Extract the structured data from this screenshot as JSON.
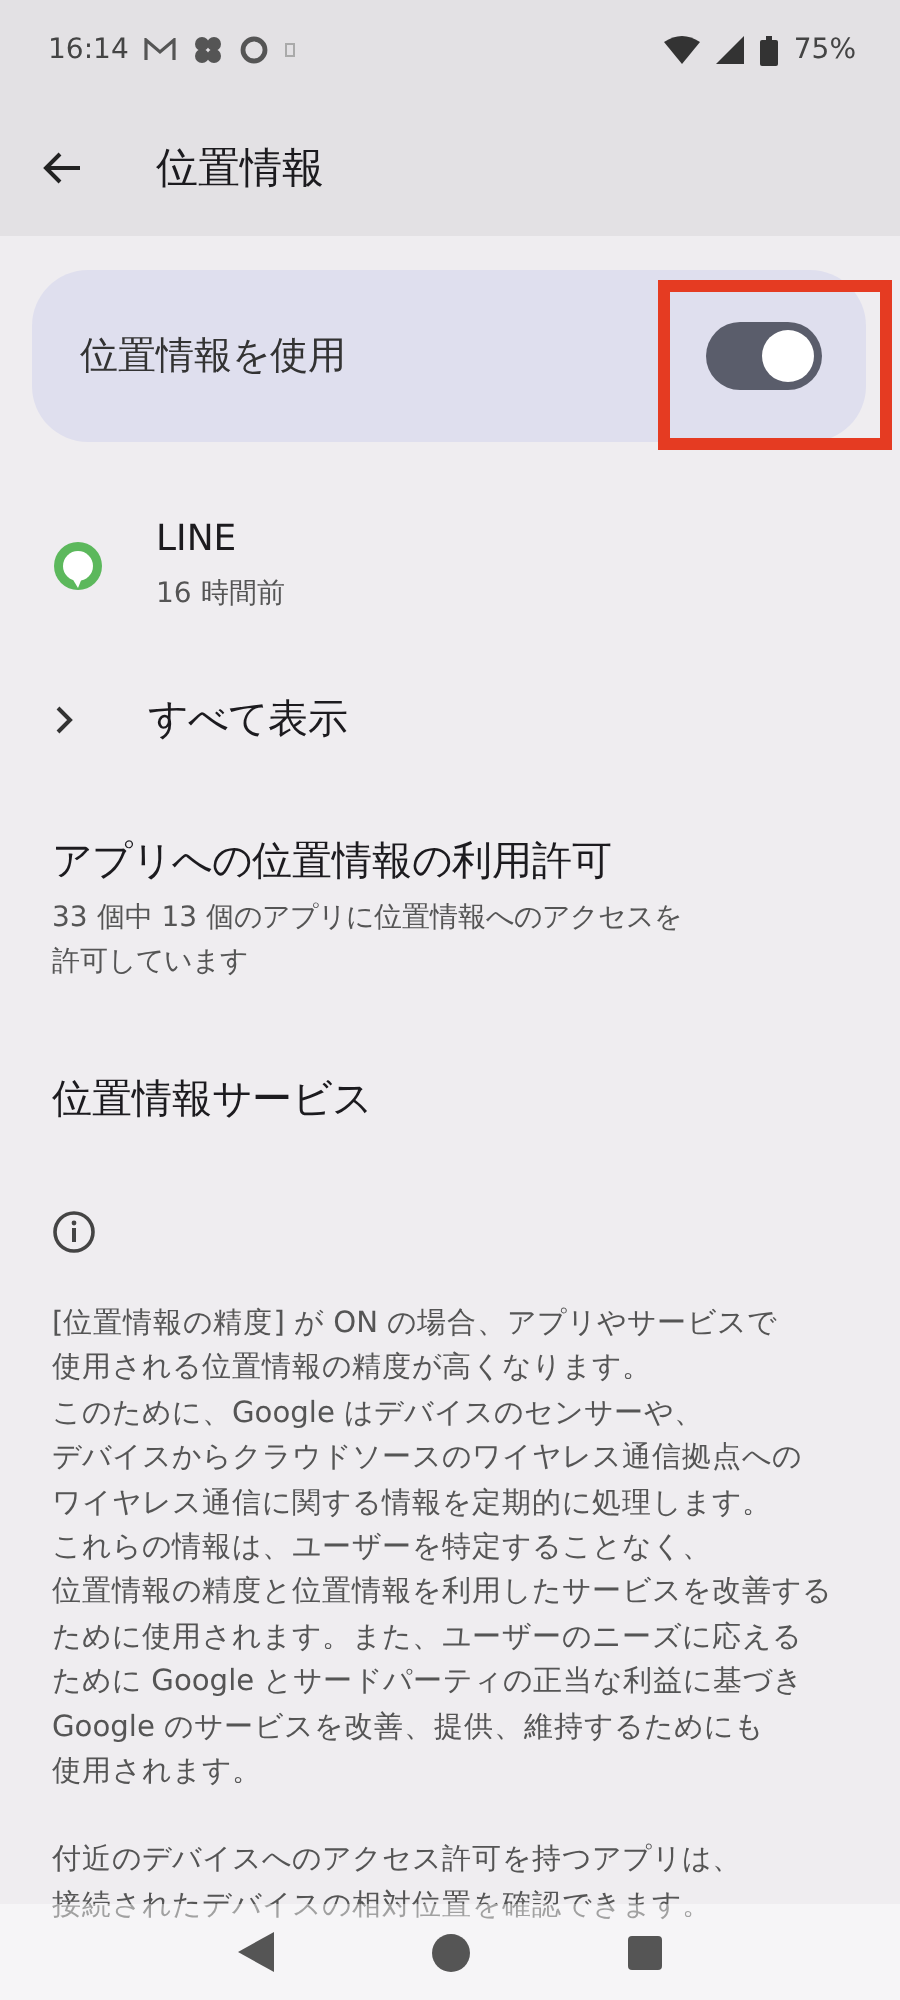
{
  "status_bar": {
    "time": "16:14",
    "battery": "75%"
  },
  "app_bar": {
    "title": "位置情報"
  },
  "master_switch": {
    "label": "位置情報を使用",
    "on": true,
    "highlighted": true
  },
  "recent_access": [
    {
      "app": "LINE",
      "time": "16 時間前"
    }
  ],
  "see_all": {
    "label": "すべて表示"
  },
  "app_permissions": {
    "title": "アプリへの位置情報の利用許可",
    "summary": [
      "33 個中 13 個のアプリに位置情報へのアクセスを",
      "許可しています"
    ]
  },
  "location_services": {
    "title": "位置情報サービス"
  },
  "footer": {
    "paragraphs": [
      [
        "[位置情報の精度] が ON の場合、アプリやサービスで",
        "使用される位置情報の精度が高くなります。",
        "このために、Google はデバイスのセンサーや、",
        "デバイスからクラウドソースのワイヤレス通信拠点への",
        "ワイヤレス通信に関する情報を定期的に処理します。",
        "これらの情報は、ユーザーを特定することなく、",
        "位置情報の精度と位置情報を利用したサービスを改善する",
        "ために使用されます。また、ユーザーのニーズに応える",
        "ために Google とサードパーティの正当な利益に基づき",
        "Google のサービスを改善、提供、維持するためにも",
        "使用されます。"
      ],
      [
        "付近のデバイスへのアクセス許可を持つアプリは、",
        "接続されたデバイスの相対位置を確認できます。"
      ]
    ]
  }
}
